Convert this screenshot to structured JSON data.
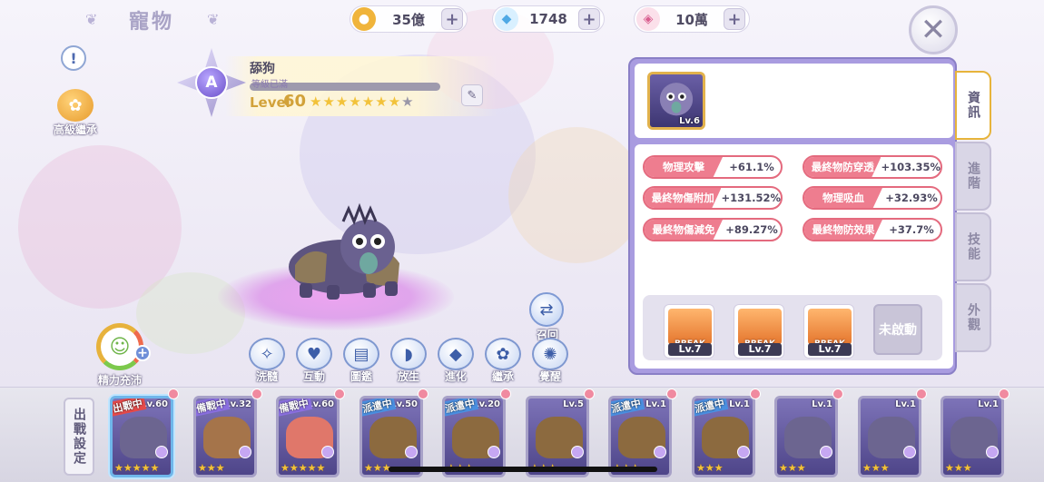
{
  "header": {
    "title": "寵物",
    "currencies": [
      {
        "icon": "gold-coin-icon",
        "value": "35億",
        "color": "#f0b43b"
      },
      {
        "icon": "diamond-icon",
        "value": "1748",
        "color": "#7fc7f5"
      },
      {
        "icon": "crystal-shard-icon",
        "value": "10萬",
        "color": "#e58ab0"
      }
    ],
    "close_label": "✕"
  },
  "left": {
    "info_label": "!",
    "inherit_label": "高級繼承",
    "stamina_label": "精力充沛"
  },
  "pet": {
    "rank": "A",
    "name": "舔狗",
    "exp_text": "等級已滿",
    "exp_fraction": 1.0,
    "level_label": "Level",
    "level_value": "60",
    "stars_total": 8,
    "stars_filled": 7,
    "recall_label": "召回"
  },
  "actions": [
    {
      "label": "洗髓",
      "icon": "wash-icon"
    },
    {
      "label": "互動",
      "icon": "heart-icon"
    },
    {
      "label": "圖鑑",
      "icon": "book-icon"
    },
    {
      "label": "放生",
      "icon": "fish-icon"
    },
    {
      "label": "進化",
      "icon": "evolve-crystal-icon"
    },
    {
      "label": "繼承",
      "icon": "candy-icon"
    },
    {
      "label": "覺醒",
      "icon": "awaken-gear-icon"
    }
  ],
  "panel": {
    "thumb_level": "Lv.6",
    "stats": [
      {
        "name": "物理攻擊",
        "value": "+61.1%"
      },
      {
        "name": "最終物防穿透",
        "value": "+103.35%"
      },
      {
        "name": "最終物傷附加",
        "value": "+131.52%"
      },
      {
        "name": "物理吸血",
        "value": "+32.93%"
      },
      {
        "name": "最終物傷減免",
        "value": "+89.27%"
      },
      {
        "name": "最終物防效果",
        "value": "+37.7%"
      }
    ],
    "breaks": [
      {
        "label": "BREAK",
        "level": "Lv.7"
      },
      {
        "label": "BREAK",
        "level": "Lv.7"
      },
      {
        "label": "BREAK",
        "level": "Lv.7"
      }
    ],
    "locked_label": "未啟動"
  },
  "side_tabs": [
    {
      "label": "資訊",
      "active": true
    },
    {
      "label": "進階",
      "active": false
    },
    {
      "label": "技能",
      "active": false
    },
    {
      "label": "外觀",
      "active": false
    }
  ],
  "bottom": {
    "deploy_label": "出戰設定",
    "cards": [
      {
        "level": "Lv.60",
        "tag": "出戰中",
        "tag_color": "#e54a4a",
        "stars": 5,
        "creature_color": "#6c6590",
        "selected": true
      },
      {
        "level": "Lv.32",
        "tag": "備戰中",
        "tag_color": "#8a6fe0",
        "stars": 3,
        "creature_color": "#a5744a",
        "selected": false
      },
      {
        "level": "Lv.60",
        "tag": "備戰中",
        "tag_color": "#8a6fe0",
        "stars": 5,
        "creature_color": "#e0776a",
        "selected": false
      },
      {
        "level": "Lv.50",
        "tag": "派遣中",
        "tag_color": "#4a8fe0",
        "stars": 3,
        "creature_color": "#8c6a3f",
        "selected": false
      },
      {
        "level": "Lv.20",
        "tag": "派遣中",
        "tag_color": "#4a8fe0",
        "stars": 3,
        "creature_color": "#8c6a3f",
        "selected": false
      },
      {
        "level": "Lv.5",
        "tag": "",
        "tag_color": "",
        "stars": 3,
        "creature_color": "#8c6a3f",
        "selected": false
      },
      {
        "level": "Lv.1",
        "tag": "派遣中",
        "tag_color": "#4a8fe0",
        "stars": 3,
        "creature_color": "#8c6a3f",
        "selected": false
      },
      {
        "level": "Lv.1",
        "tag": "派遣中",
        "tag_color": "#4a8fe0",
        "stars": 3,
        "creature_color": "#8c6a3f",
        "selected": false
      },
      {
        "level": "Lv.1",
        "tag": "",
        "tag_color": "",
        "stars": 3,
        "creature_color": "#6c6590",
        "selected": false
      },
      {
        "level": "Lv.1",
        "tag": "",
        "tag_color": "",
        "stars": 3,
        "creature_color": "#6c6590",
        "selected": false
      },
      {
        "level": "Lv.1",
        "tag": "",
        "tag_color": "",
        "stars": 3,
        "creature_color": "#6c6590",
        "selected": false
      }
    ]
  }
}
